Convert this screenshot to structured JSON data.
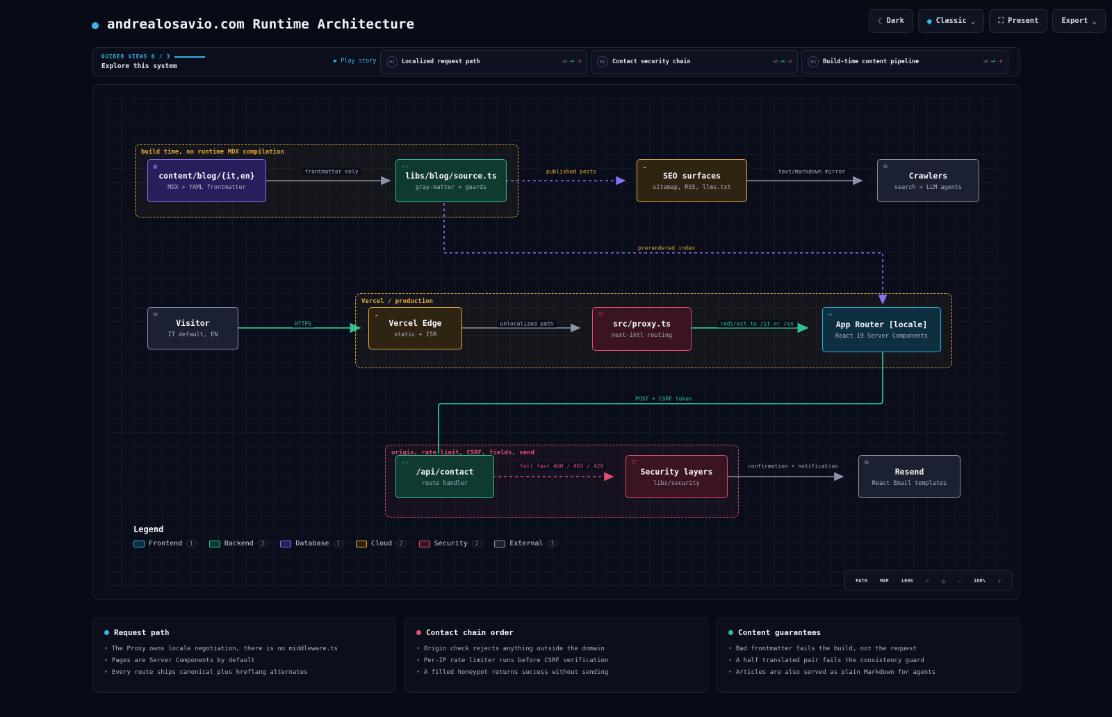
{
  "header": {
    "title": "andrealosavio.com Runtime Architecture",
    "buttons": [
      {
        "label": "Dark",
        "icon": "moon-icon"
      },
      {
        "label": "Classic",
        "icon": "circle-icon"
      },
      {
        "label": "Present",
        "icon": "fullscreen-icon"
      },
      {
        "label": "Export",
        "icon": "chevron-down-icon"
      }
    ]
  },
  "guided": {
    "label": "GUIDED VIEWS 0 / 3",
    "subtitle": "Explore this system",
    "play_label": "▶ Play story",
    "views": [
      {
        "num": "01",
        "title": "Localized request path",
        "stats_a": "≡8",
        "stats_b": "+4",
        "stats_c": "-8"
      },
      {
        "num": "02",
        "title": "Contact security chain",
        "stats_a": "≡8",
        "stats_b": "+4",
        "stats_c": "-8"
      },
      {
        "num": "03",
        "title": "Build-time content pipeline",
        "stats_a": "≡8",
        "stats_b": "+4",
        "stats_c": "-8"
      }
    ]
  },
  "colors": {
    "frontend": "#2fa9d6",
    "backend": "#2fbf94",
    "database": "#8b6ff2",
    "cloud": "#e3a83a",
    "security": "#e24f72",
    "external": "#8a93a8",
    "accent": "#37b7e6"
  },
  "groups": [
    {
      "id": "build",
      "label": "build time, no runtime MDX compilation",
      "color": "#e3a83a"
    },
    {
      "id": "vercel",
      "label": "Vercel / production",
      "color": "#e3a83a"
    },
    {
      "id": "contact",
      "label": "origin, rate limit, CSRF, fields, send",
      "color": "#e24f72"
    }
  ],
  "nodes": [
    {
      "id": "content",
      "title": "content/blog/{it,en}",
      "sub": "MDX + YAML frontmatter",
      "type": "database",
      "icon": "database-icon"
    },
    {
      "id": "source",
      "title": "libs/blog/source.ts",
      "sub": "gray-matter + guards",
      "type": "backend",
      "icon": "code-icon"
    },
    {
      "id": "seo",
      "title": "SEO surfaces",
      "sub": "sitemap, RSS, llms.txt",
      "type": "cloud",
      "icon": "cloud-icon"
    },
    {
      "id": "crawlers",
      "title": "Crawlers",
      "sub": "search + LLM agents",
      "type": "external",
      "icon": "external-link-icon"
    },
    {
      "id": "visitor",
      "title": "Visitor",
      "sub": "IT default, EN",
      "type": "external",
      "icon": "external-link-icon"
    },
    {
      "id": "edge",
      "title": "Vercel Edge",
      "sub": "static + ISR",
      "type": "cloud",
      "icon": "cloud-icon"
    },
    {
      "id": "proxy",
      "title": "src/proxy.ts",
      "sub": "next-intl routing",
      "type": "security",
      "icon": "shield-icon"
    },
    {
      "id": "router",
      "title": "App Router [locale]",
      "sub": "React 19 Server Components",
      "type": "frontend",
      "icon": "window-icon"
    },
    {
      "id": "api",
      "title": "/api/contact",
      "sub": "route handler",
      "type": "backend",
      "icon": "code-icon"
    },
    {
      "id": "security",
      "title": "Security layers",
      "sub": "libs/security",
      "type": "security",
      "icon": "shield-icon"
    },
    {
      "id": "resend",
      "title": "Resend",
      "sub": "React Email templates",
      "type": "external",
      "icon": "external-link-icon"
    }
  ],
  "edges": [
    {
      "id": "e1",
      "label": "frontmatter only",
      "style": "solid",
      "color": "#8a93a8"
    },
    {
      "id": "e2",
      "label": "published posts",
      "style": "dashed",
      "color": "#8b6ff2",
      "label_color": "#e3a83a"
    },
    {
      "id": "e3",
      "label": "text/markdown mirror",
      "style": "solid",
      "color": "#8a93a8"
    },
    {
      "id": "e4",
      "label": "prerendered index",
      "style": "dashed",
      "color": "#8b6ff2",
      "label_color": "#e3a83a"
    },
    {
      "id": "e5",
      "label": "HTTPS",
      "style": "solid",
      "color": "#2fbf94"
    },
    {
      "id": "e6",
      "label": "unlocalized path",
      "style": "solid",
      "color": "#8a93a8"
    },
    {
      "id": "e7",
      "label": "redirect to /it or /en",
      "style": "solid",
      "color": "#2fbf94"
    },
    {
      "id": "e8",
      "label": "POST + CSRF token",
      "style": "solid",
      "color": "#2fbf94"
    },
    {
      "id": "e9",
      "label": "fail fast 400 / 403 / 429",
      "style": "dashed",
      "color": "#e24f72"
    },
    {
      "id": "e10",
      "label": "confirmation + notification",
      "style": "solid",
      "color": "#8a93a8"
    }
  ],
  "legend": {
    "title": "Legend",
    "items": [
      {
        "label": "Frontend",
        "count": "1",
        "type": "frontend"
      },
      {
        "label": "Backend",
        "count": "2",
        "type": "backend"
      },
      {
        "label": "Database",
        "count": "1",
        "type": "database"
      },
      {
        "label": "Cloud",
        "count": "2",
        "type": "cloud"
      },
      {
        "label": "Security",
        "count": "2",
        "type": "security"
      },
      {
        "label": "External",
        "count": "3",
        "type": "external"
      }
    ]
  },
  "toolbar": {
    "path": "PATH",
    "map": "MAP",
    "lens": "LENS",
    "zoom": "100%",
    "minus": "−",
    "plus": "+"
  },
  "info_cards": [
    {
      "title": "Request path",
      "dot": "#37b7e6",
      "items": [
        "The Proxy owns locale negotiation, there is no middleware.ts",
        "Pages are Server Components by default",
        "Every route ships canonical plus hreflang alternates"
      ]
    },
    {
      "title": "Contact chain order",
      "dot": "#e24f72",
      "items": [
        "Origin check rejects anything outside the domain",
        "Per-IP rate limiter runs before CSRF verification",
        "A filled honeypot returns success without sending"
      ]
    },
    {
      "title": "Content guarantees",
      "dot": "#2fbf94",
      "items": [
        "Bad frontmatter fails the build, not the request",
        "A half translated pair fails the consistency guard",
        "Articles are also served as plain Markdown for agents"
      ]
    }
  ]
}
